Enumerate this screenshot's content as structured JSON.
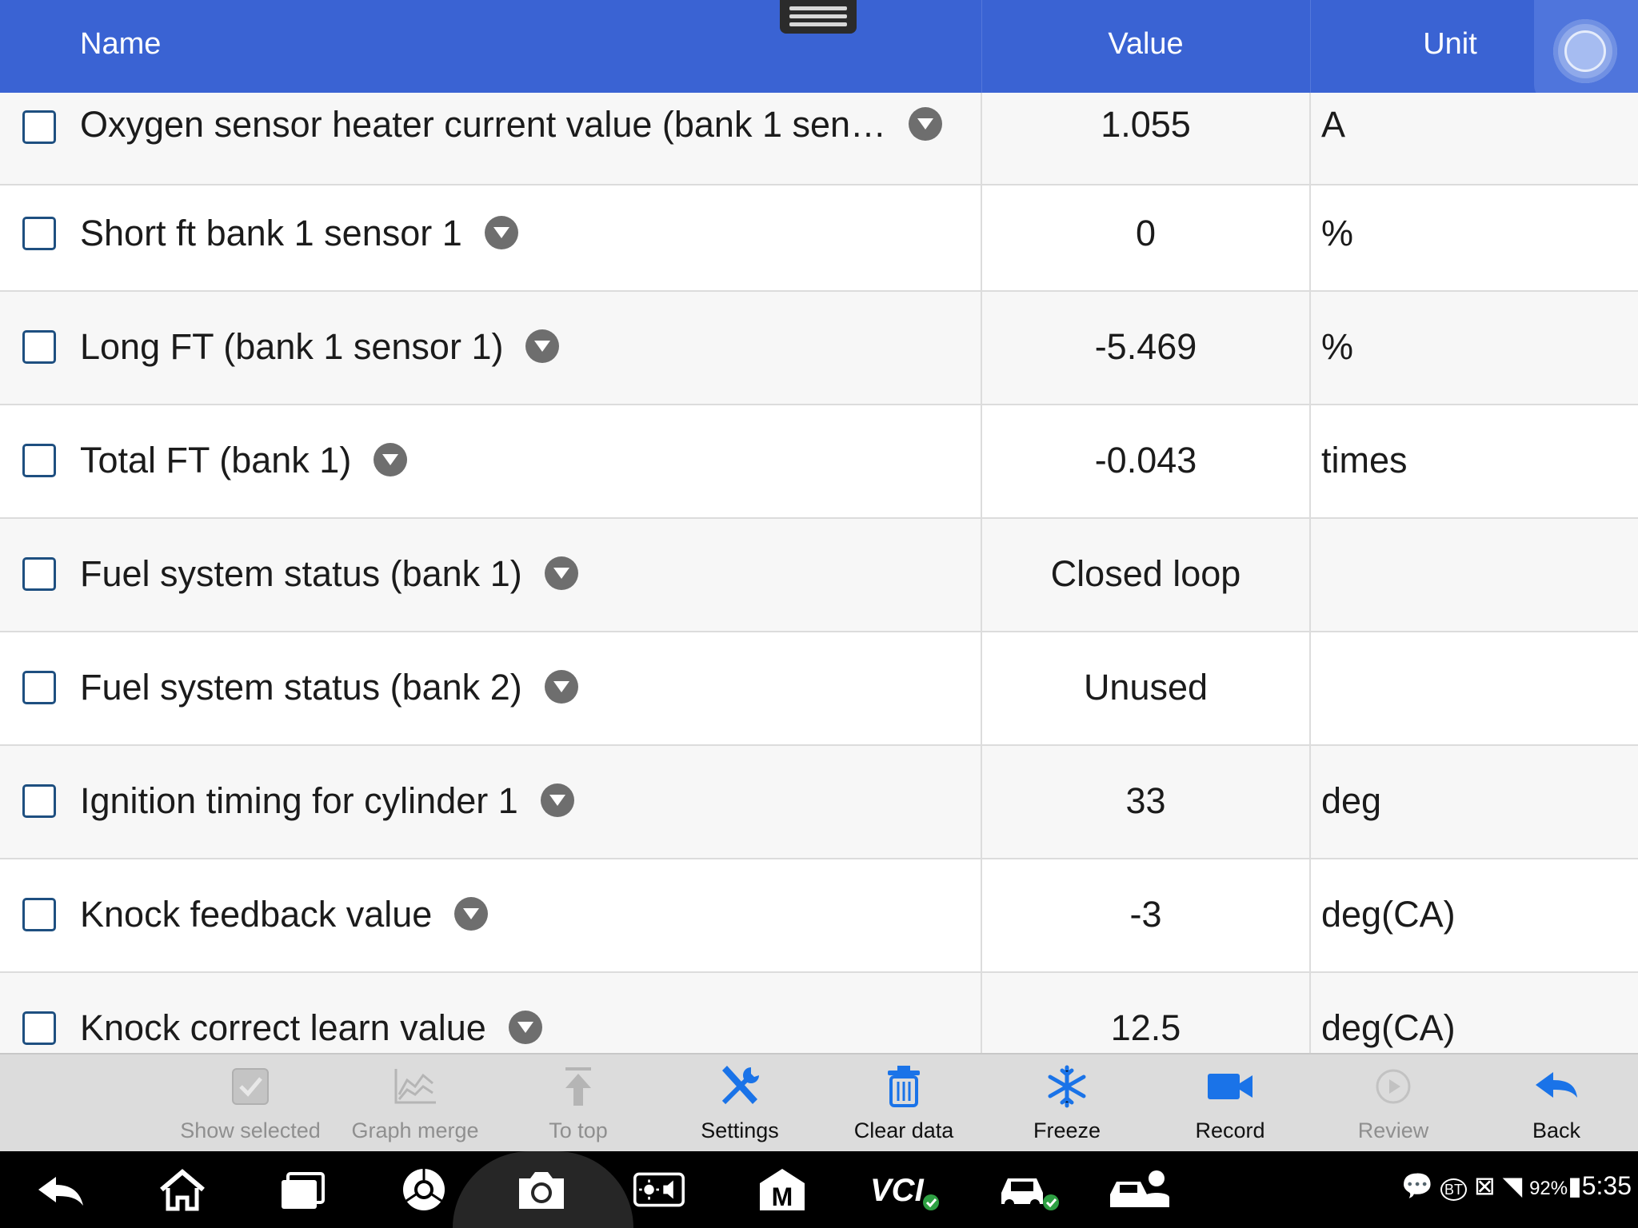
{
  "header": {
    "name_label": "Name",
    "value_label": "Value",
    "unit_label": "Unit"
  },
  "rows": [
    {
      "name": "Oxygen sensor heater current value (bank 1 sen…",
      "value": "1.055",
      "unit": "A"
    },
    {
      "name": "Short ft bank 1 sensor 1",
      "value": "0",
      "unit": "%"
    },
    {
      "name": "Long FT (bank 1 sensor 1)",
      "value": "-5.469",
      "unit": "%"
    },
    {
      "name": "Total FT (bank 1)",
      "value": "-0.043",
      "unit": "times"
    },
    {
      "name": "Fuel system status (bank 1)",
      "value": "Closed loop",
      "unit": ""
    },
    {
      "name": "Fuel system status (bank 2)",
      "value": "Unused",
      "unit": ""
    },
    {
      "name": "Ignition timing for cylinder 1",
      "value": "33",
      "unit": "deg"
    },
    {
      "name": "Knock feedback value",
      "value": "-3",
      "unit": "deg(CA)"
    },
    {
      "name": "Knock correct learn value",
      "value": "12.5",
      "unit": "deg(CA)"
    }
  ],
  "toolbar": {
    "show_selected": "Show selected",
    "graph_merge": "Graph merge",
    "to_top": "To top",
    "settings": "Settings",
    "clear_data": "Clear data",
    "freeze": "Freeze",
    "record": "Record",
    "review": "Review",
    "back": "Back"
  },
  "navbar": {
    "icons": [
      "back-icon",
      "home-icon",
      "recent-apps-icon",
      "chrome-icon",
      "camera-icon",
      "brightness-volume-icon",
      "maxifix-icon",
      "vci-icon",
      "car-icon",
      "car-service-icon"
    ],
    "vci_label": "VCI",
    "m_label": "M"
  },
  "statusbar": {
    "bt_label": "BT",
    "battery": "92%",
    "time": "5:35"
  },
  "colors": {
    "header": "#3a63d3",
    "toolbar": "#dcdcdc",
    "accent_blue": "#1a73e8",
    "navbar": "#000000"
  }
}
